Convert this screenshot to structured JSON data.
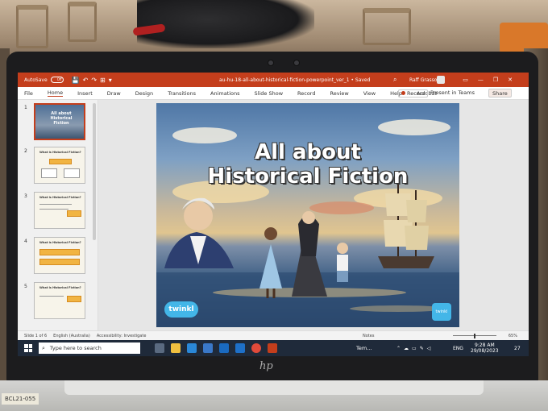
{
  "app": {
    "autosave_label": "AutoSave",
    "autosave_state": "Off",
    "document_title": "au-hu-18-all-about-historical-fiction-powerpoint_ver_1 • Saved",
    "user_name": "Raff Grasso",
    "search_icon": "search-icon",
    "accent_color": "#c43e1c"
  },
  "ribbon": {
    "tabs": [
      "File",
      "Home",
      "Insert",
      "Draw",
      "Design",
      "Transitions",
      "Animations",
      "Slide Show",
      "Record",
      "Review",
      "View",
      "Help",
      "Acrobat"
    ],
    "record_button": "Record",
    "present_button": "Present in Teams",
    "share_button": "Share"
  },
  "thumbnails": {
    "numbers": [
      "1",
      "2",
      "3",
      "4",
      "5"
    ],
    "slide1_title": "All about Historical Fiction",
    "slide_titles": [
      "What is Historical Fiction?",
      "What is Historical Fiction?",
      "What is Historical Fiction?",
      "What is Historical Fiction?"
    ]
  },
  "slide": {
    "title_line1": "All about",
    "title_line2": "Historical Fiction",
    "logo_left": "twinkl",
    "logo_right": "twinkl"
  },
  "status": {
    "slide_counter": "Slide 1 of 6",
    "language": "English (Australia)",
    "accessibility": "Accessibility: Investigate",
    "notes": "Notes",
    "zoom": "65%"
  },
  "taskbar": {
    "search_placeholder": "Type here to search",
    "weather": "Tem...",
    "language": "ENG",
    "time": "9:28 AM",
    "date": "29/08/2023",
    "notifications": "27"
  },
  "physical": {
    "laptop_brand": "hp",
    "asset_sticker": "BCL21-055"
  }
}
